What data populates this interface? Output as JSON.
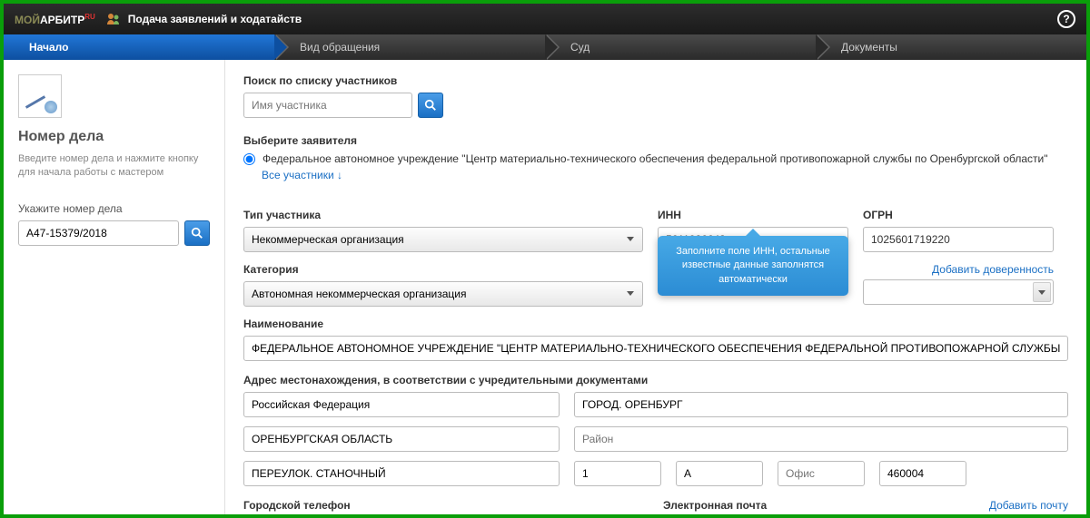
{
  "header": {
    "logo_moi": "МОЙ",
    "logo_arbitr": "АРБИТР",
    "logo_ru": "RU",
    "title": "Подача заявлений и ходатайств"
  },
  "steps": {
    "s1": "Начало",
    "s2": "Вид обращения",
    "s3": "Суд",
    "s4": "Документы"
  },
  "sidebar": {
    "title": "Номер дела",
    "hint": "Введите номер дела и нажмите кнопку для начала работы с мастером",
    "label": "Укажите номер дела",
    "case_number": "А47-15379/2018"
  },
  "content": {
    "search_label": "Поиск по списку участников",
    "search_placeholder": "Имя участника",
    "applicant_label": "Выберите заявителя",
    "applicant_name": "Федеральное автономное учреждение \"Центр материально-технического обеспечения федеральной противопожарной службы по Оренбургской области\"",
    "all_link": "Все участники ↓",
    "participant_type_label": "Тип участника",
    "participant_type_value": "Некоммерческая организация",
    "inn_label": "ИНН",
    "inn_value": "5611026643",
    "ogrn_label": "ОГРН",
    "ogrn_value": "1025601719220",
    "category_label": "Категория",
    "category_value": "Автономная некоммерческая организация",
    "add_poa_link": "Добавить доверенность",
    "tooltip": "Заполните поле ИНН, остальные известные данные заполнятся автоматически",
    "name_label": "Наименование",
    "name_value": "ФЕДЕРАЛЬНОЕ АВТОНОМНОЕ УЧРЕЖДЕНИЕ \"ЦЕНТР МАТЕРИАЛЬНО-ТЕХНИЧЕСКОГО ОБЕСПЕЧЕНИЯ ФЕДЕРАЛЬНОЙ ПРОТИВОПОЖАРНОЙ СЛУЖБЫ ПО ОРЕНБУРГСКОЙ ОБЛАСТИ",
    "address_label": "Адрес местонахождения, в соответствии с учредительными документами",
    "address": {
      "country": "Российская Федерация",
      "city": "ГОРОД. ОРЕНБУРГ",
      "region": "ОРЕНБУРГСКАЯ ОБЛАСТЬ",
      "district_placeholder": "Район",
      "street": "ПЕРЕУЛОК. СТАНОЧНЫЙ",
      "house": "1",
      "building": "А",
      "office_placeholder": "Офис",
      "postal": "460004"
    },
    "phone_label": "Городской телефон",
    "email_label": "Электронная почта",
    "add_email_link": "Добавить почту"
  }
}
